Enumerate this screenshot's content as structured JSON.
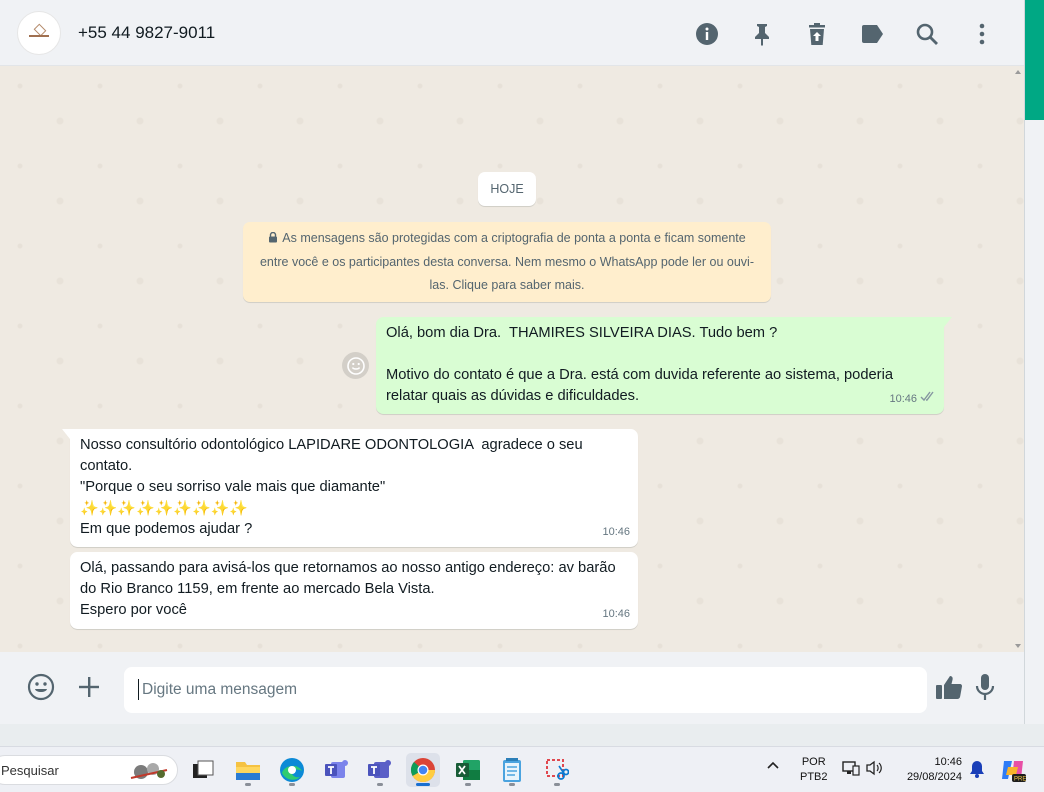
{
  "header": {
    "contact_name": "+55 44 9827-9011",
    "avatar_logo": "LAPIDARE"
  },
  "chat": {
    "date_divider": "HOJE",
    "encryption_notice": "As mensagens são protegidas com a criptografia de ponta a ponta e ficam somente entre você e os participantes desta conversa. Nem mesmo o WhatsApp pode ler ou ouvi-las. Clique para saber mais.",
    "messages": [
      {
        "direction": "outgoing",
        "text": "Olá, bom dia Dra.  THAMIRES SILVEIRA DIAS. Tudo bem ?\n\nMotivo do contato é que a Dra. está com duvida referente ao sistema, poderia relatar quais as dúvidas e dificuldades.",
        "time": "10:46",
        "status": "delivered-double-check"
      },
      {
        "direction": "incoming",
        "text": "Nosso consultório odontológico LAPIDARE ODONTOLOGIA  agradece o seu contato.\n\"Porque o seu sorriso vale mais que diamante\"",
        "emoji": "✨✨✨✨✨✨✨✨✨",
        "text_after": "Em que podemos ajudar ?",
        "time": "10:46"
      },
      {
        "direction": "incoming",
        "text": "Olá, passando para avisá-los que retornamos ao nosso antigo endereço: av barão do Rio Branco 1159, em frente ao mercado Bela Vista.\nEspero por você",
        "time": "10:46"
      }
    ]
  },
  "composer": {
    "placeholder": "Digite uma mensagem"
  },
  "taskbar": {
    "search_placeholder": "Pesquisar",
    "language_line1": "POR",
    "language_line2": "PTB2",
    "time": "10:46",
    "date": "29/08/2024"
  },
  "colors": {
    "outgoing_bubble": "#d9fdd3",
    "incoming_bubble": "#ffffff",
    "encryption_bg": "#ffeecd",
    "chat_bg": "#efeae2",
    "accent": "#00a884"
  }
}
